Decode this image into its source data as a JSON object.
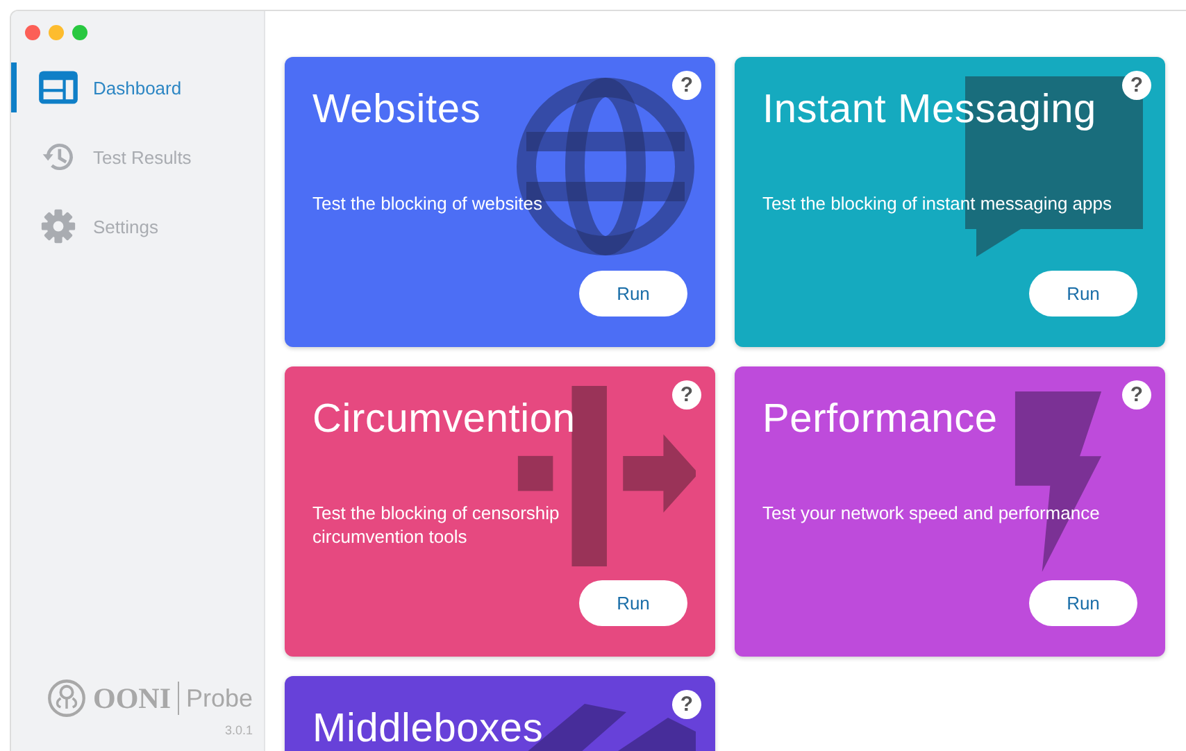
{
  "sidebar": {
    "items": [
      {
        "label": "Dashboard",
        "kind": "dashboard",
        "selected": true
      },
      {
        "label": "Test Results",
        "kind": "history",
        "selected": false
      },
      {
        "label": "Settings",
        "kind": "gear",
        "selected": false
      }
    ],
    "brand": {
      "name": "OONI",
      "product": "Probe",
      "version": "3.0.1"
    }
  },
  "cards": [
    {
      "title": "Websites",
      "description": "Test the blocking of websites",
      "button": "Run",
      "kind": "globe",
      "color": "#4c6ef5",
      "help": "?"
    },
    {
      "title": "Instant Messaging",
      "description": "Test the blocking of instant messaging apps",
      "button": "Run",
      "kind": "chat",
      "color": "#15aabf",
      "help": "?"
    },
    {
      "title": "Circumvention",
      "description": "Test the blocking of censorship circumvention tools",
      "button": "Run",
      "kind": "circumvention",
      "color": "#e64980",
      "help": "?"
    },
    {
      "title": "Performance",
      "description": "Test your network speed and performance",
      "button": "Run",
      "kind": "bolt",
      "color": "#be4bdb",
      "help": "?"
    },
    {
      "title": "Middleboxes",
      "kind": "middlebox",
      "color": "#6741d9",
      "help": "?"
    }
  ]
}
